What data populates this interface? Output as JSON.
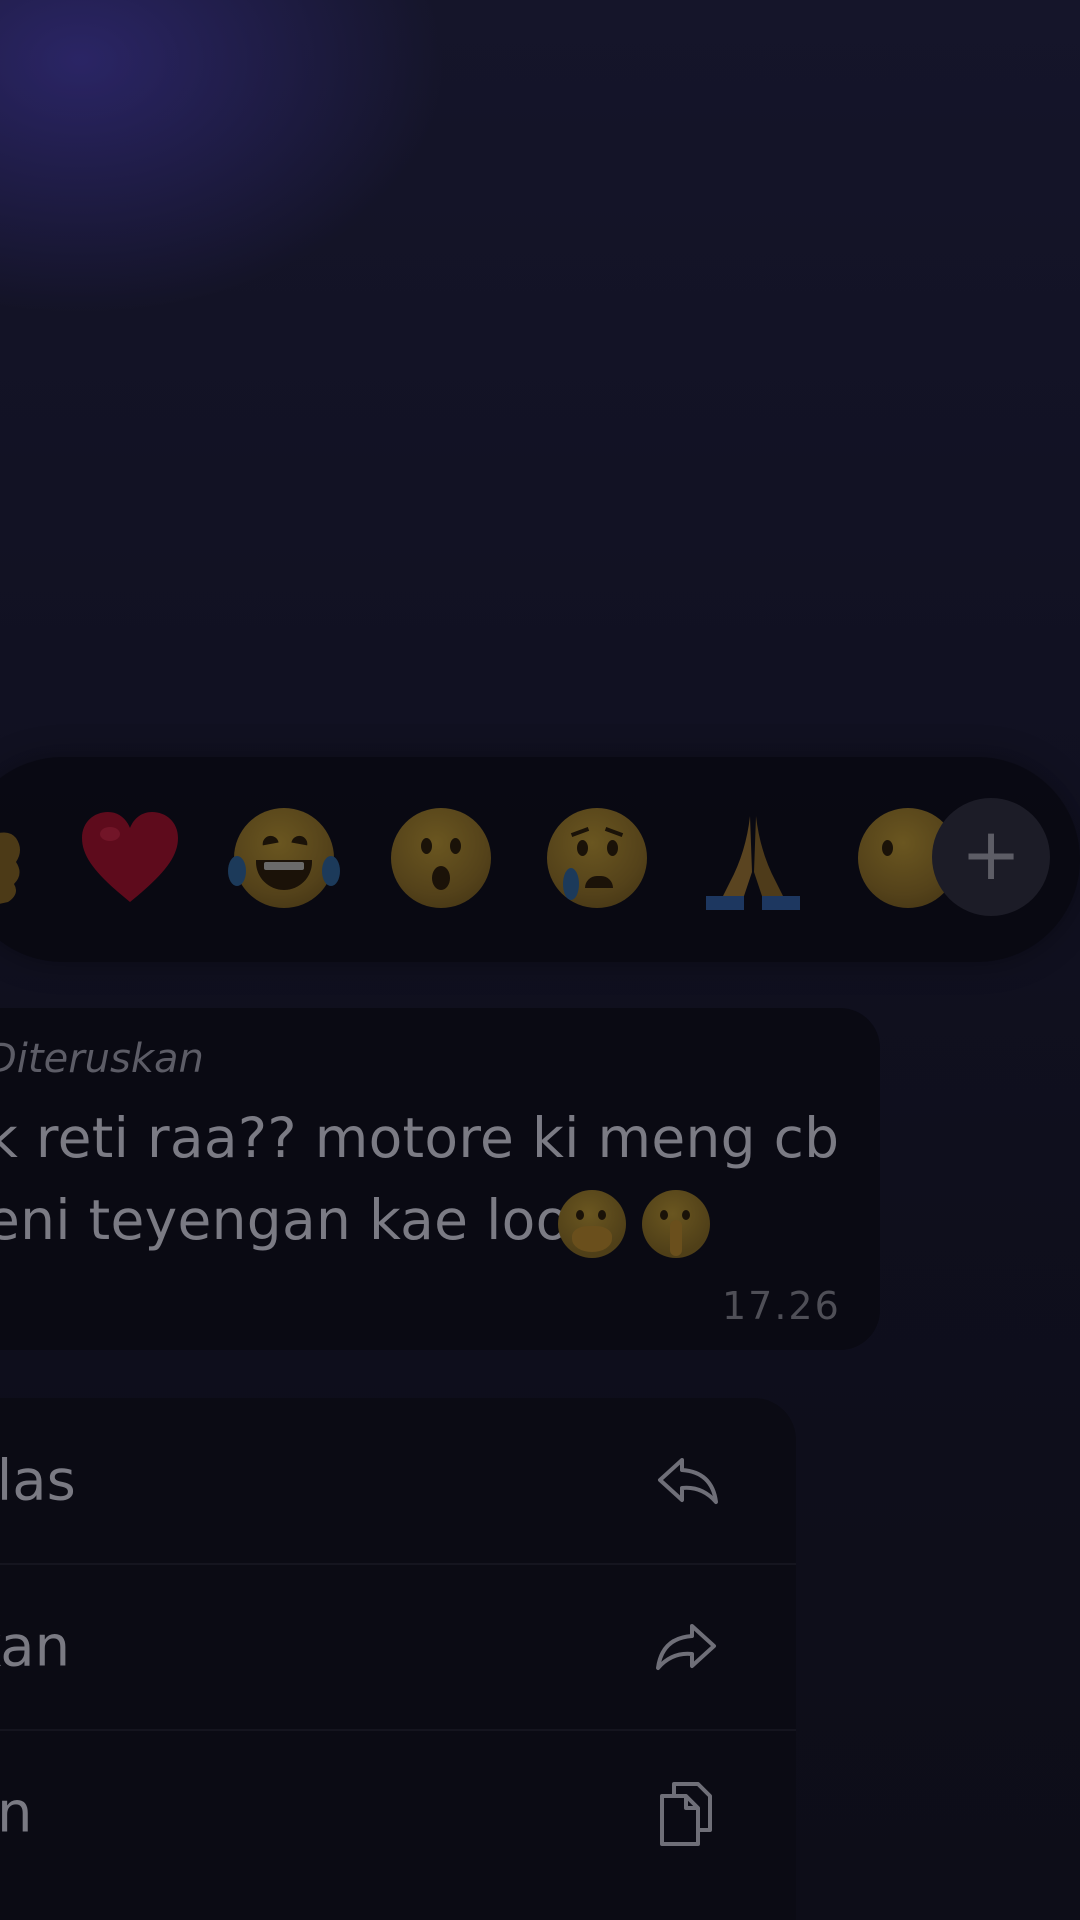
{
  "reactions": {
    "items": [
      "thumbs-up",
      "heart",
      "tears-of-joy",
      "surprised",
      "crying",
      "folded-hands",
      "partial-face"
    ],
    "more_label": "+"
  },
  "message": {
    "forwarded_label": "Diteruskan",
    "lines": [
      "k reti raa?? motore ki meng cb",
      "eni teyengan kae loo"
    ],
    "timestamp": "17.26"
  },
  "menu": {
    "items": [
      {
        "label": "Balas",
        "icon": "reply-icon"
      },
      {
        "label": "Teruskan",
        "icon": "forward-icon"
      },
      {
        "label": "Salin",
        "icon": "copy-icon"
      }
    ]
  },
  "colors": {
    "background": "#0d0d19",
    "bubble": "#0a0a13",
    "text": "#7b7b84",
    "accent_glow": "#3c3296"
  }
}
